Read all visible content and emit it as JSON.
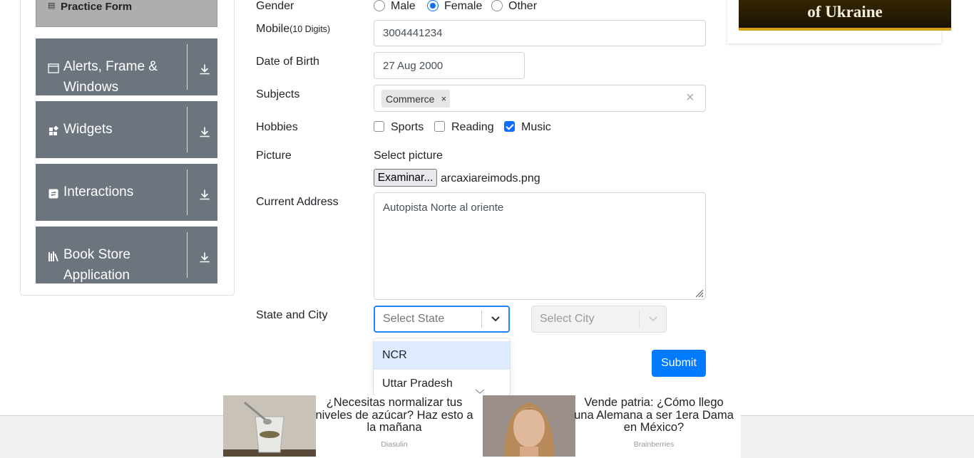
{
  "sidebar": {
    "practice_form": "Practice Form",
    "groups": [
      {
        "label": "Alerts, Frame & Windows",
        "icon": "window-icon"
      },
      {
        "label": "Widgets",
        "icon": "widgets-icon"
      },
      {
        "label": "Interactions",
        "icon": "interactions-icon"
      },
      {
        "label": "Book Store Application",
        "icon": "books-icon"
      }
    ]
  },
  "form": {
    "gender_label": "Gender",
    "gender_options": [
      "Male",
      "Female",
      "Other"
    ],
    "gender_selected": "Female",
    "mobile_label": "Mobile",
    "mobile_hint": "(10 Digits)",
    "mobile_value": "3004441234",
    "dob_label": "Date of Birth",
    "dob_value": "27 Aug 2000",
    "subjects_label": "Subjects",
    "subjects": [
      "Commerce"
    ],
    "subject_remove": "×",
    "subjects_clear": "×",
    "hobbies_label": "Hobbies",
    "hobbies": [
      {
        "label": "Sports",
        "checked": false
      },
      {
        "label": "Reading",
        "checked": false
      },
      {
        "label": "Music",
        "checked": true
      }
    ],
    "picture_label": "Picture",
    "picture_select": "Select picture",
    "file_button": "Examinar...",
    "file_name": "arcaxiareimods.png",
    "address_label": "Current Address",
    "address_value": "Autopista Norte al oriente",
    "state_city_label": "State and City",
    "state_placeholder": "Select State",
    "city_placeholder": "Select City",
    "state_options": [
      "NCR",
      "Uttar Pradesh"
    ],
    "submit": "Submit"
  },
  "ads": {
    "top_banner": "of Ukraine",
    "bottom": [
      {
        "title": "¿Necesitas normalizar tus niveles de azúcar? Haz esto a la mañana",
        "source": "Diasulin"
      },
      {
        "title": "Vende patria: ¿Cómo llego una Alemana a ser 1era Dama en México?",
        "source": "Brainberries"
      }
    ]
  },
  "colors": {
    "accent": "#007bff",
    "sidebar_group": "#6c757d",
    "select_focus": "#2684ff"
  }
}
